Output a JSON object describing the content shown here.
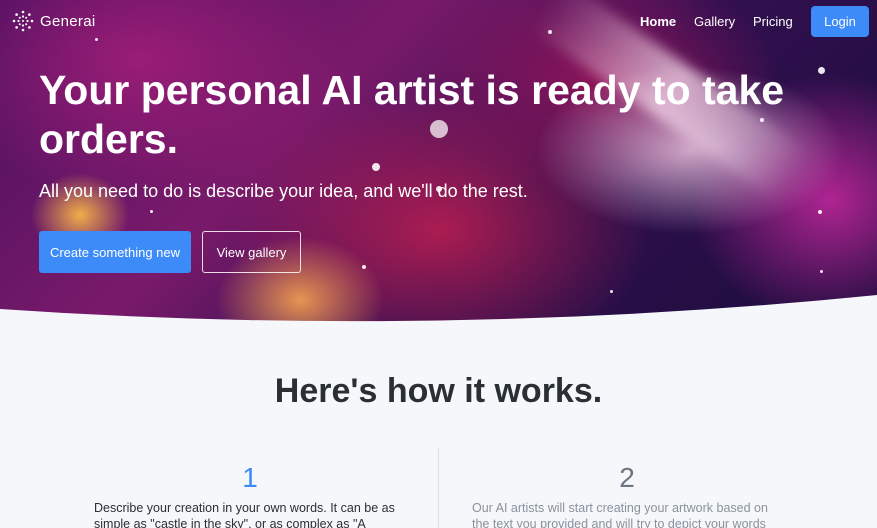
{
  "nav": {
    "brand": "Generai",
    "links": [
      {
        "label": "Home",
        "active": true
      },
      {
        "label": "Gallery",
        "active": false
      },
      {
        "label": "Pricing",
        "active": false
      }
    ],
    "login_label": "Login"
  },
  "hero": {
    "title": "Your personal AI artist is ready to take orders.",
    "subtitle": "All you need to do is describe your idea, and we'll do the rest.",
    "primary_button": "Create something new",
    "secondary_button": "View gallery"
  },
  "how_it_works": {
    "title": "Here's how it works.",
    "steps": [
      {
        "number": "1",
        "text": "Describe your creation in your own words. It can be as simple as \"castle in the sky\", or as complex as \"A"
      },
      {
        "number": "2",
        "text": "Our AI artists will start creating your artwork based on the text you provided and will try to depict your words as"
      }
    ]
  },
  "colors": {
    "accent": "#3d8bf8",
    "page_background": "#f5f7fb"
  }
}
